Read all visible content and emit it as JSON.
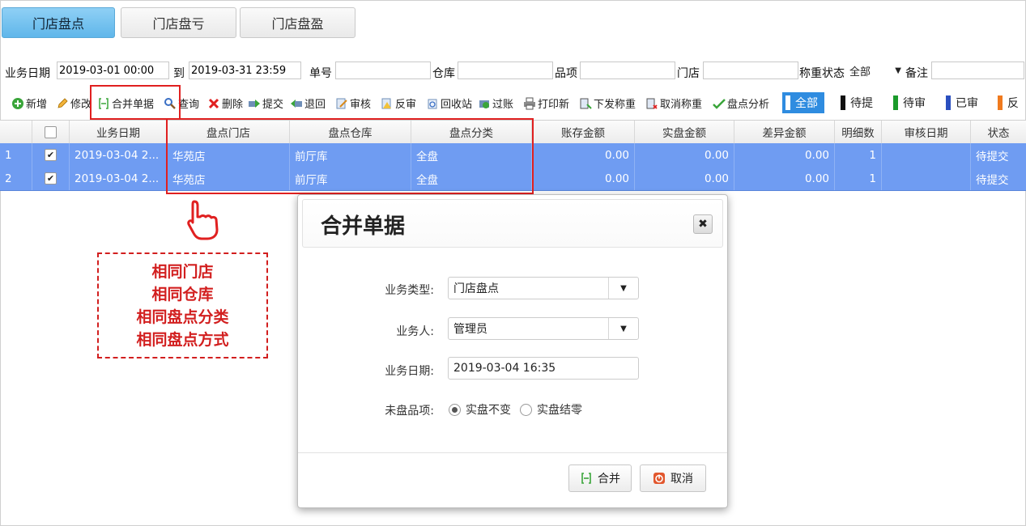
{
  "tabs": [
    {
      "label": "门店盘点",
      "active": true
    },
    {
      "label": "门店盘亏",
      "active": false
    },
    {
      "label": "门店盘盈",
      "active": false
    }
  ],
  "filter": {
    "date_label": "业务日期",
    "date_from": "2019-03-01 00:00",
    "to_label": "到",
    "date_to": "2019-03-31 23:59",
    "order_no_label": "单号",
    "order_no": "",
    "warehouse_label": "仓库",
    "warehouse": "",
    "item_label": "品项",
    "item": "",
    "store_label": "门店",
    "store": "",
    "weigh_status_label": "称重状态",
    "weigh_status": "全部",
    "remark_label": "备注",
    "remark": ""
  },
  "toolbar": {
    "items": [
      "新增",
      "修改",
      "合并单据",
      "查询",
      "删除",
      "提交",
      "退回",
      "审核",
      "反审",
      "回收站",
      "过账",
      "打印新",
      "下发称重",
      "取消称重",
      "盘点分析"
    ],
    "status_tabs": [
      {
        "label": "全部",
        "color": "#ffffff",
        "active": true
      },
      {
        "label": "待提",
        "color": "#111111",
        "active": false
      },
      {
        "label": "待审",
        "color": "#1a9a2a",
        "active": false
      },
      {
        "label": "已审",
        "color": "#2a4fbf",
        "active": false
      },
      {
        "label": "反",
        "color": "#f07a1e",
        "active": false
      }
    ]
  },
  "table": {
    "columns": [
      "",
      "",
      "业务日期",
      "盘点门店",
      "盘点仓库",
      "盘点分类",
      "账存金额",
      "实盘金额",
      "差异金额",
      "明细数",
      "审核日期",
      "状态"
    ],
    "rows": [
      {
        "index": "1",
        "checked": true,
        "date": "2019-03-04 2...",
        "store": "华苑店",
        "warehouse": "前厅库",
        "category": "全盘",
        "book_amount": "0.00",
        "actual_amount": "0.00",
        "diff_amount": "0.00",
        "detail_count": "1",
        "audit_date": "",
        "status": "待提交"
      },
      {
        "index": "2",
        "checked": true,
        "date": "2019-03-04 2...",
        "store": "华苑店",
        "warehouse": "前厅库",
        "category": "全盘",
        "book_amount": "0.00",
        "actual_amount": "0.00",
        "diff_amount": "0.00",
        "detail_count": "1",
        "audit_date": "",
        "status": "待提交"
      }
    ]
  },
  "annotation": {
    "lines": [
      "相同门店",
      "相同仓库",
      "相同盘点分类",
      "相同盘点方式"
    ]
  },
  "dialog": {
    "title": "合并单据",
    "close_glyph": "✖",
    "type_label": "业务类型:",
    "type_value": "门店盘点",
    "person_label": "业务人:",
    "person_value": "管理员",
    "date_label": "业务日期:",
    "date_value": "2019-03-04 16:35",
    "unchecked_label": "未盘品项:",
    "option_keep": "实盘不变",
    "option_zero": "实盘结零",
    "selected_option": "实盘不变",
    "merge_button": "合并",
    "cancel_button": "取消"
  },
  "colors": {
    "selected_row": "#6f9cf2",
    "highlight_red": "#e02020",
    "active_tab": "#5fb6ea"
  }
}
